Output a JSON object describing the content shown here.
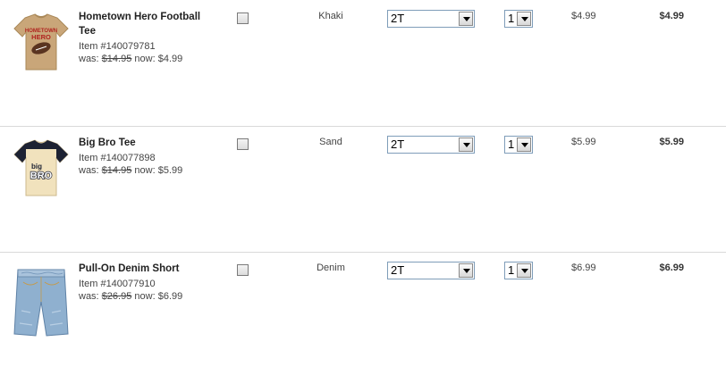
{
  "cart": {
    "items": [
      {
        "name": "Hometown Hero Football Tee",
        "item_number": "Item #140079781",
        "was_label": "was:",
        "was_price": "$14.95",
        "now_label": "now:",
        "now_price": "$4.99",
        "color": "Khaki",
        "size": "2T",
        "quantity": "1",
        "unit_price": "$4.99",
        "total_price": "$4.99",
        "image_icon": "football-tee-image",
        "image_text": [
          "HOMETOWN",
          "HERO"
        ]
      },
      {
        "name": "Big Bro Tee",
        "item_number": "Item #140077898",
        "was_label": "was:",
        "was_price": "$14.95",
        "now_label": "now:",
        "now_price": "$5.99",
        "color": "Sand",
        "size": "2T",
        "quantity": "1",
        "unit_price": "$5.99",
        "total_price": "$5.99",
        "image_icon": "big-bro-tee-image",
        "image_text": [
          "big",
          "BRO"
        ]
      },
      {
        "name": "Pull-On Denim Short",
        "item_number": "Item #140077910",
        "was_label": "was:",
        "was_price": "$26.95",
        "now_label": "now:",
        "now_price": "$6.99",
        "color": "Denim",
        "size": "2T",
        "quantity": "1",
        "unit_price": "$6.99",
        "total_price": "$6.99",
        "image_icon": "denim-short-image"
      }
    ]
  },
  "colors": {
    "khaki_shirt": "#c9a679",
    "sand_shirt": "#f1e2bd",
    "navy_sleeve": "#1d2233",
    "denim": "#8fb0cf",
    "select_border": "#7f9db9",
    "row_divider": "#d9d9d9"
  }
}
